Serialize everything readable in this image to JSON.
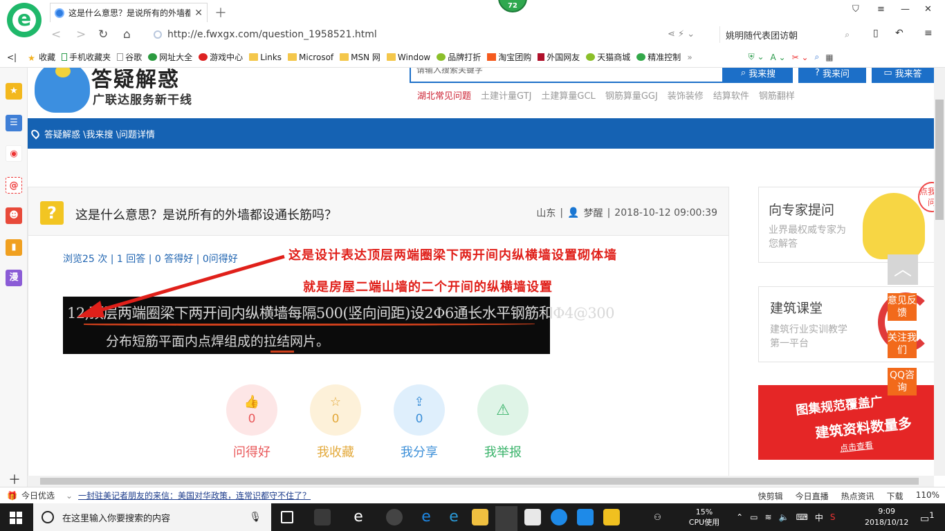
{
  "browser": {
    "tab_title": "这是什么意思？是说所有的外墙都",
    "badge": "72",
    "url": "http://e.fwxgx.com/question_1958521.html",
    "search_text": "姚明随代表团访朝"
  },
  "bookmarks": [
    "收藏",
    "手机收藏夹",
    "谷歌",
    "网址大全",
    "游戏中心",
    "Links",
    "Microsof",
    "MSN 网",
    "Window",
    "品牌打折",
    "淘宝团购",
    "外国网友",
    "天猫商城",
    "精准控制"
  ],
  "site": {
    "title": "答疑解惑",
    "subtitle": "广联达服务新干线",
    "search_placeholder": "请输入搜索关键字",
    "btn_search": "我来搜",
    "btn_ask": "我来问",
    "btn_answer": "我来答",
    "hotlinks": [
      "湖北常见问题",
      "土建计量GTJ",
      "土建算量GCL",
      "钢筋算量GGJ",
      "装饰装修",
      "结算软件",
      "钢筋翻样"
    ],
    "breadcrumb": "答疑解惑 \\我来搜 \\问题详情"
  },
  "question": {
    "icon": "?",
    "title": "这是什么意思？是说所有的外墙都设通长筋吗？",
    "region": "山东",
    "author": "梦醒",
    "datetime": "2018-10-12 09:00:39",
    "stats": "浏览25 次 | 1 回答 | 0 答得好 | 0问得好",
    "note_line1": "这是设计表达顶层两端圈梁下两开间内纵横墙设置砌体墙",
    "note_line2": "就是房屋二端山墙的二个开间的纵横墙设置",
    "image_line1": "12,顶层两端圈梁下两开间内纵横墙每隔500(竖向间距)设2Φ6通长水平钢筋和Φ4@300",
    "image_line2": "分布短筋平面内点焊组成的拉结网片。"
  },
  "actions": [
    {
      "label": "问得好",
      "count": "0",
      "color": "#e9585a",
      "bg": "#fde6e6",
      "icon": "thumbs-up-icon"
    },
    {
      "label": "我收藏",
      "count": "0",
      "color": "#e3a93b",
      "bg": "#fdf1d9",
      "icon": "star-icon"
    },
    {
      "label": "我分享",
      "count": "0",
      "color": "#3c8fd8",
      "bg": "#dfeffc",
      "icon": "share-icon"
    },
    {
      "label": "我举报",
      "count": "",
      "color": "#39b36a",
      "bg": "#dff4e7",
      "icon": "warning-icon"
    }
  ],
  "right": {
    "expert_title": "向专家提问",
    "expert_sub": "业界最权威专家为您解答",
    "expert_tag": "点我提问",
    "course_title": "建筑课堂",
    "course_sub": "建筑行业实训教学第一平台",
    "ad_line1": "图集规范覆盖广",
    "ad_line2": "建筑资料数量多",
    "ad_link": "点击查看",
    "float_feedback": "意见反馈",
    "float_follow": "关注我们",
    "float_qq": "QQ咨询",
    "backtop": "︿"
  },
  "statusbar": {
    "today": "今日优选",
    "news": "一封驻美记者朋友的来信：美国对华政策，连常识都守不住了？",
    "items": [
      "快剪辑",
      "今日直播",
      "热点资讯",
      "下载",
      "110%"
    ]
  },
  "taskbar": {
    "search_placeholder": "在这里输入你要搜索的内容",
    "cpu": "15%",
    "cpu_label": "CPU使用",
    "ime": "中",
    "time": "9:09",
    "date": "2018/10/12",
    "notif": "1"
  },
  "sidebar_icons": [
    "star-icon",
    "news-icon",
    "weibo-icon",
    "mail-icon",
    "game-icon",
    "book-icon",
    "comic-icon"
  ]
}
